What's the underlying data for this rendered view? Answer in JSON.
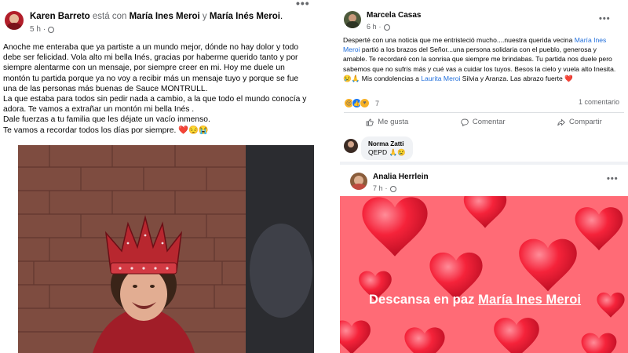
{
  "left_post": {
    "author": "Karen Barreto",
    "with_text": "está con",
    "tag1": "María Ines Meroi",
    "and_text": "y",
    "tag2": "María Inés Meroi",
    "end_punct": ".",
    "time": "5 h",
    "dot_sep": "·",
    "menu": "•••",
    "paragraphs": [
      "Anoche me enteraba que ya partiste a un mundo mejor, dónde no hay dolor y todo debe ser felicidad. Vola alto mi bella Inés, gracias por haberme querido tanto y por siempre alentarme con un mensaje, por siempre creer en mi. Hoy me duele un montón tu partida porque ya no voy a recibir más un mensaje tuyo y porque se fue una de las personas más buenas de Sauce MONTRULL.",
      "La que estaba para todos sin pedir nada a cambio, a la que todo el mundo conocía y adora. Te vamos a extrañar un montón mi bella Inés .",
      "Dale fuerzas a tu familia que les déjate un vacío inmenso.",
      "Te vamos a recordar todos los días por siempre. ❤️😔😭"
    ]
  },
  "right_post": {
    "author": "Marcela Casas",
    "time": "6 h",
    "dot_sep": "·",
    "menu": "•••",
    "text_a": "Desperté con una noticia que me entristeció mucho....nuestra querida vecina ",
    "link1": "María Ines Meroi",
    "text_b": " partió a los brazos del Señor...una persona solidaria con el pueblo, generosa y amable. Te recordaré con la sonrisa que siempre me brindabas. Tu partida nos duele pero sabemos que no sufrís más y cué vas a cuidar los tuyos. Besos la cielo y vuela alto Inesita.😢🙏  Mis condolencias a ",
    "link2": "Laurita Meroi",
    "text_c": " Silvia y Aranza. Las abrazo fuerte ❤️",
    "reaction_count": "7",
    "comments_count": "1 comentario",
    "actions": {
      "like": "Me gusta",
      "comment": "Comentar",
      "share": "Compartir"
    },
    "comment": {
      "author": "Norma Zatti",
      "text": "QEPD 🙏😢"
    }
  },
  "third_post": {
    "author": "Analia Herrlein",
    "time": "7 h",
    "dot_sep": "·",
    "menu": "•••",
    "banner_prefix": "Descansa en paz ",
    "banner_tag": "María Ines Meroi"
  },
  "colors": {
    "accent_link": "#216fdb",
    "heart_bg": "#ff5966",
    "heart": "#f5233a"
  }
}
